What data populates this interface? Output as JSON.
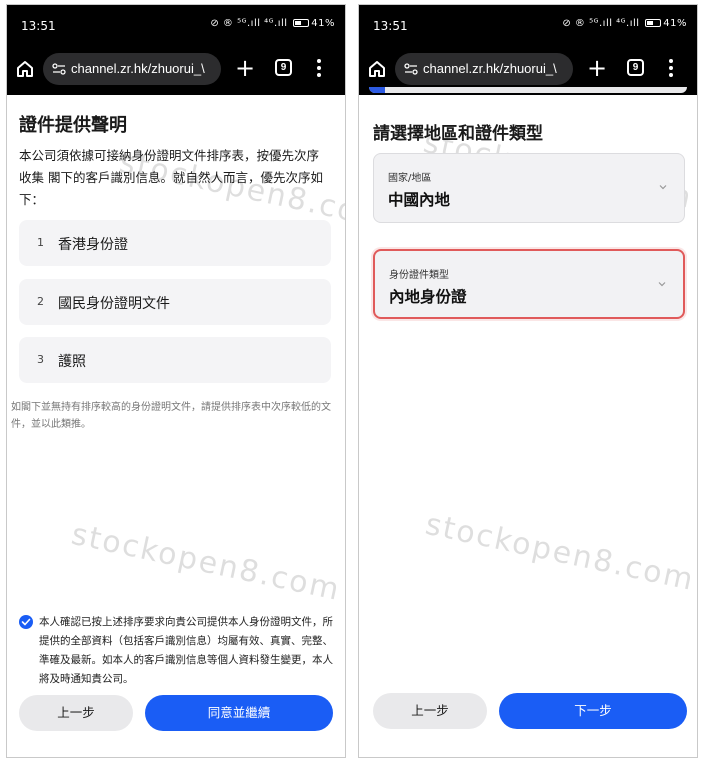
{
  "left": {
    "status": {
      "time": "13:51",
      "indicators": "⊘ ® ⁵ᴳ.ıll ⁴ᴳ.ıll",
      "battery": "41%"
    },
    "browser": {
      "url": "channel.zr.hk/zhuorui_\\",
      "tab_count": "9"
    },
    "watermark": "stockopen8.com",
    "title": "證件提供聲明",
    "intro": "本公司須依據可接納身份證明文件排序表，按優先次序收集 閣下的客戶識別信息。就自然人而言，優先次序如下：",
    "documents": [
      {
        "num": "1",
        "label": "香港身份證"
      },
      {
        "num": "2",
        "label": "國民身份證明文件"
      },
      {
        "num": "3",
        "label": "護照"
      }
    ],
    "note": "如閣下並無持有排序較高的身份證明文件，請提供排序表中次序較低的文件，並以此類推。",
    "consent": "本人確認已按上述排序要求向貴公司提供本人身份證明文件，所提供的全部資料（包括客戶識別信息）均屬有效、真實、完整、準確及最新。如本人的客戶識別信息等個人資料發生變更，本人將及時通知貴公司。",
    "buttons": {
      "back": "上一步",
      "agree": "同意並繼續"
    }
  },
  "right": {
    "status": {
      "time": "13:51",
      "indicators": "⊘ ® ⁵ᴳ.ıll ⁴ᴳ.ıll",
      "battery": "41%"
    },
    "browser": {
      "url": "channel.zr.hk/zhuorui_\\",
      "tab_count": "9"
    },
    "watermark": "stockopen8.com",
    "progress": 0.05,
    "title": "請選擇地區和證件類型",
    "region": {
      "label": "國家/地區",
      "value": "中國內地"
    },
    "id_type": {
      "label": "身份證件類型",
      "value": "內地身份證"
    },
    "buttons": {
      "back": "上一步",
      "next": "下一步"
    }
  },
  "colors": {
    "primary": "#1a5df5",
    "error_border": "#e05a5a",
    "card_bg": "#f4f4f6"
  }
}
